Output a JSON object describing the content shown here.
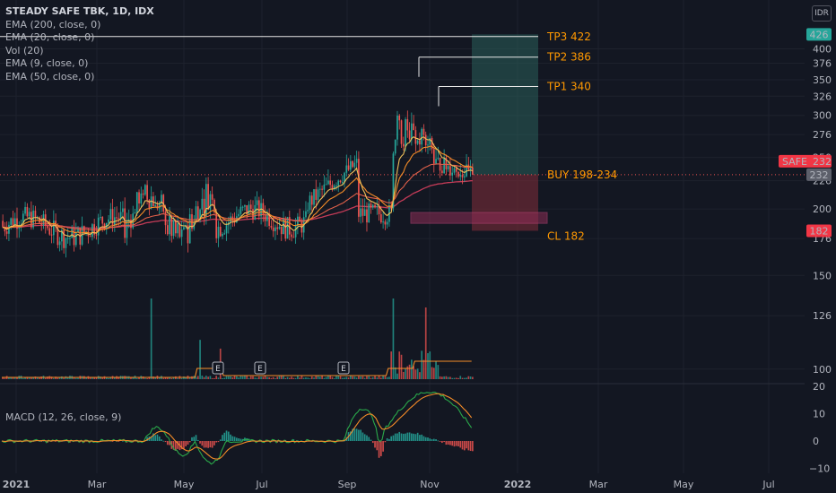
{
  "header": {
    "title": "STEADY SAFE TBK, 1D, IDX",
    "currency": "IDR",
    "indicators": [
      "EMA (200, close, 0)",
      "EMA (20, close, 0)",
      "Vol (20)",
      "EMA (9, close, 0)",
      "EMA (50, close, 0)"
    ],
    "macd_label": "MACD (12, 26, close, 9)"
  },
  "colors": {
    "background": "#131722",
    "up": "#26a69a",
    "down": "#ef5350",
    "ema9": "#f0c05a",
    "ema20": "#f48c28",
    "ema50": "#e0604a",
    "ema200": "#c43b57",
    "tp_zone": "#2a5e5a",
    "sl_zone": "#6b2a34",
    "tp_text": "#ff9800",
    "last_price": "#f23645",
    "axis_text": "#b2b5be"
  },
  "chart_data": {
    "type": "candlestick",
    "symbol": "SAFE",
    "interval": "1D",
    "exchange": "IDX",
    "x_ticks": [
      "2021",
      "Mar",
      "May",
      "Jul",
      "Sep",
      "Nov",
      "2022",
      "Mar",
      "May",
      "Jul"
    ],
    "price_ticks": [
      100,
      126,
      150,
      176,
      200,
      226,
      250,
      276,
      300,
      326,
      350,
      376,
      400
    ],
    "price_axis_labels": [
      {
        "value": 426,
        "label": "426",
        "color": "#26a69a"
      },
      {
        "value": 232,
        "label": "232",
        "color": "#5d606b"
      },
      {
        "value": 182,
        "label": "182",
        "color": "#f23645"
      }
    ],
    "last_price_tag": {
      "symbol": "SAFE",
      "value": 232
    },
    "macd_ticks": [
      20,
      10,
      0,
      -10
    ],
    "price_scale": {
      "type": "log",
      "range": [
        95,
        440
      ]
    },
    "earnings_markers": [
      {
        "label": "E",
        "date": "2021-04-26"
      },
      {
        "label": "E",
        "date": "2021-06-10"
      },
      {
        "label": "E",
        "date": "2021-08-30"
      }
    ],
    "annotations": [
      {
        "label": "TP3 422",
        "value": 422
      },
      {
        "label": "TP2 386",
        "value": 386
      },
      {
        "label": "TP1 340",
        "value": 340
      },
      {
        "label": "BUY 198-234",
        "value": 232
      },
      {
        "label": "CL 182",
        "value": 182
      }
    ],
    "trade_zones": {
      "entry": 232,
      "target": 426,
      "stop": 182,
      "buy_low": 198,
      "buy_high": 234
    }
  }
}
